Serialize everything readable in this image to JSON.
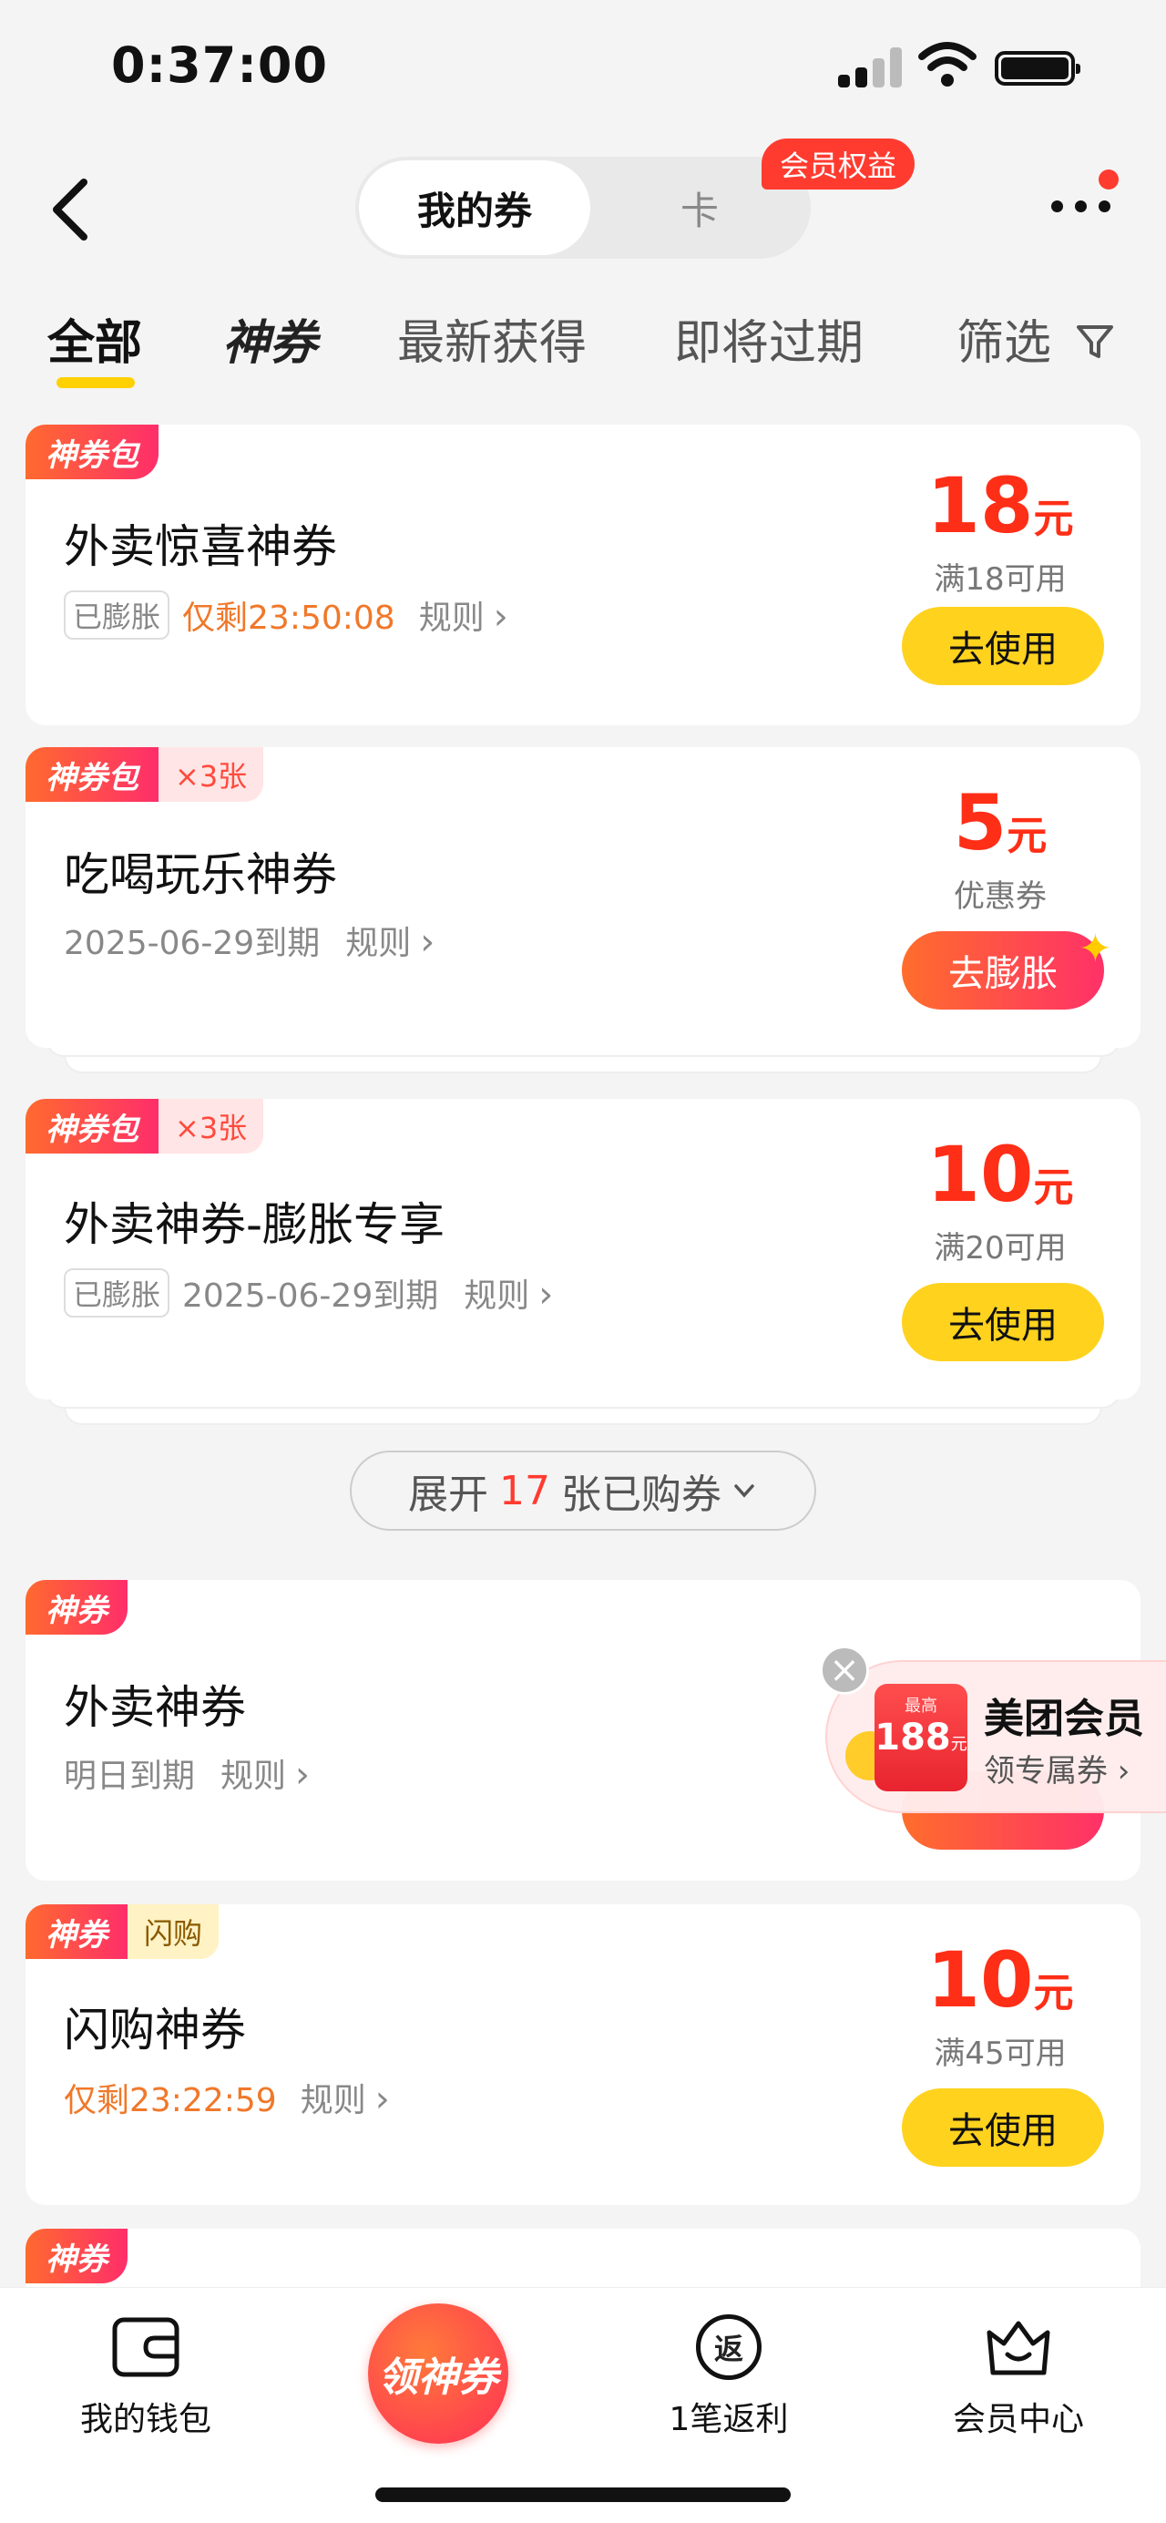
{
  "status": {
    "time": "0:37:00"
  },
  "header": {
    "segments": [
      {
        "label": "我的券",
        "active": true
      },
      {
        "label": "卡",
        "active": false
      }
    ],
    "vip_badge": "会员权益"
  },
  "filters": [
    "全部",
    "神券",
    "最新获得",
    "即将过期",
    "筛选"
  ],
  "coupons": [
    {
      "tag": "神券包",
      "title": "外卖惊喜神券",
      "status": "已膨胀",
      "countdown": "仅剩23:50:08",
      "rule": "规则",
      "amount": "18",
      "unit": "元",
      "condition": "满18可用",
      "action": "去使用"
    },
    {
      "tag": "神券包",
      "qty": "×3张",
      "title": "吃喝玩乐神券",
      "expiry": "2025-06-29到期",
      "rule": "规则",
      "amount": "5",
      "unit": "元",
      "condition": "优惠券",
      "action": "去膨胀"
    },
    {
      "tag": "神券包",
      "qty": "×3张",
      "title": "外卖神券-膨胀专享",
      "status": "已膨胀",
      "expiry": "2025-06-29到期",
      "rule": "规则",
      "amount": "10",
      "unit": "元",
      "condition": "满20可用",
      "action": "去使用"
    },
    {
      "tag": "神券",
      "title": "外卖神券",
      "expiry": "明日到期",
      "rule": "规则"
    },
    {
      "tag": "神券",
      "flag": "闪购",
      "title": "闪购神券",
      "countdown": "仅剩23:22:59",
      "rule": "规则",
      "amount": "10",
      "unit": "元",
      "condition": "满45可用",
      "action": "去使用"
    },
    {
      "tag": "神券"
    }
  ],
  "expand": {
    "prefix": "展开",
    "count": "17",
    "suffix": "张已购券"
  },
  "floating_promo": {
    "small": "最高",
    "value": "188",
    "unit": "元",
    "title": "美团会员",
    "subtitle": "领专属券"
  },
  "nav": {
    "wallet": "我的钱包",
    "center": "领神券",
    "rebate_icon": "返",
    "rebate": "1笔返利",
    "vip": "会员中心"
  },
  "colors": {
    "accent_yellow": "#ffd21e",
    "price_red": "#ff2e17",
    "brand_gradient": "#ff3168"
  }
}
